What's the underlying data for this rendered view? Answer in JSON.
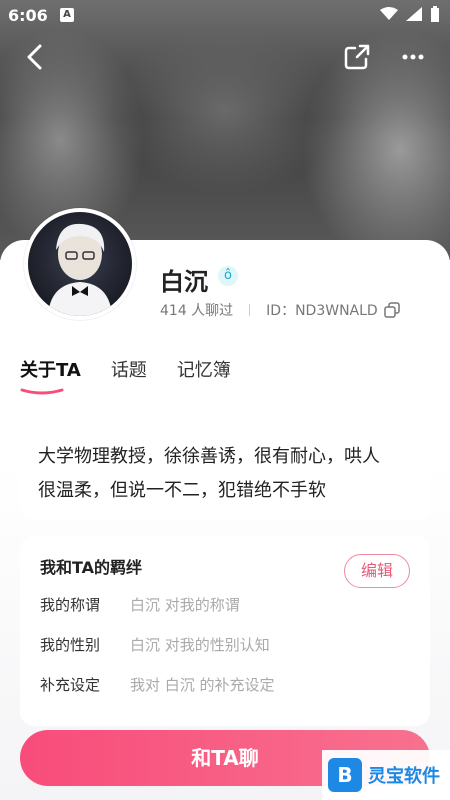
{
  "status_bar": {
    "time": "6:06",
    "app_letter": "A"
  },
  "profile": {
    "name": "白沉",
    "chat_count_text": "414 人聊过",
    "id_text": "ID：ND3WNALD"
  },
  "tabs": [
    {
      "label": "关于TA",
      "active": true
    },
    {
      "label": "话题",
      "active": false
    },
    {
      "label": "记忆簿",
      "active": false
    }
  ],
  "bio": {
    "line1": "大学物理教授，徐徐善诱，很有耐心，哄人",
    "line2": "很温柔，但说一不二，犯错绝不手软"
  },
  "bond": {
    "title": "我和TA的羁绊",
    "edit_label": "编辑",
    "rows": [
      {
        "label": "我的称谓",
        "value": "白沉 对我的称谓"
      },
      {
        "label": "我的性别",
        "value": "白沉 对我的性别认知"
      },
      {
        "label": "补充设定",
        "value": "我对 白沉 的补充设定"
      }
    ]
  },
  "chat_button_label": "和TA聊",
  "watermark_text": "灵宝软件",
  "colors": {
    "accent": "#f84c7a",
    "accent_light": "#f8718f",
    "edit_border": "#f08aa0"
  }
}
